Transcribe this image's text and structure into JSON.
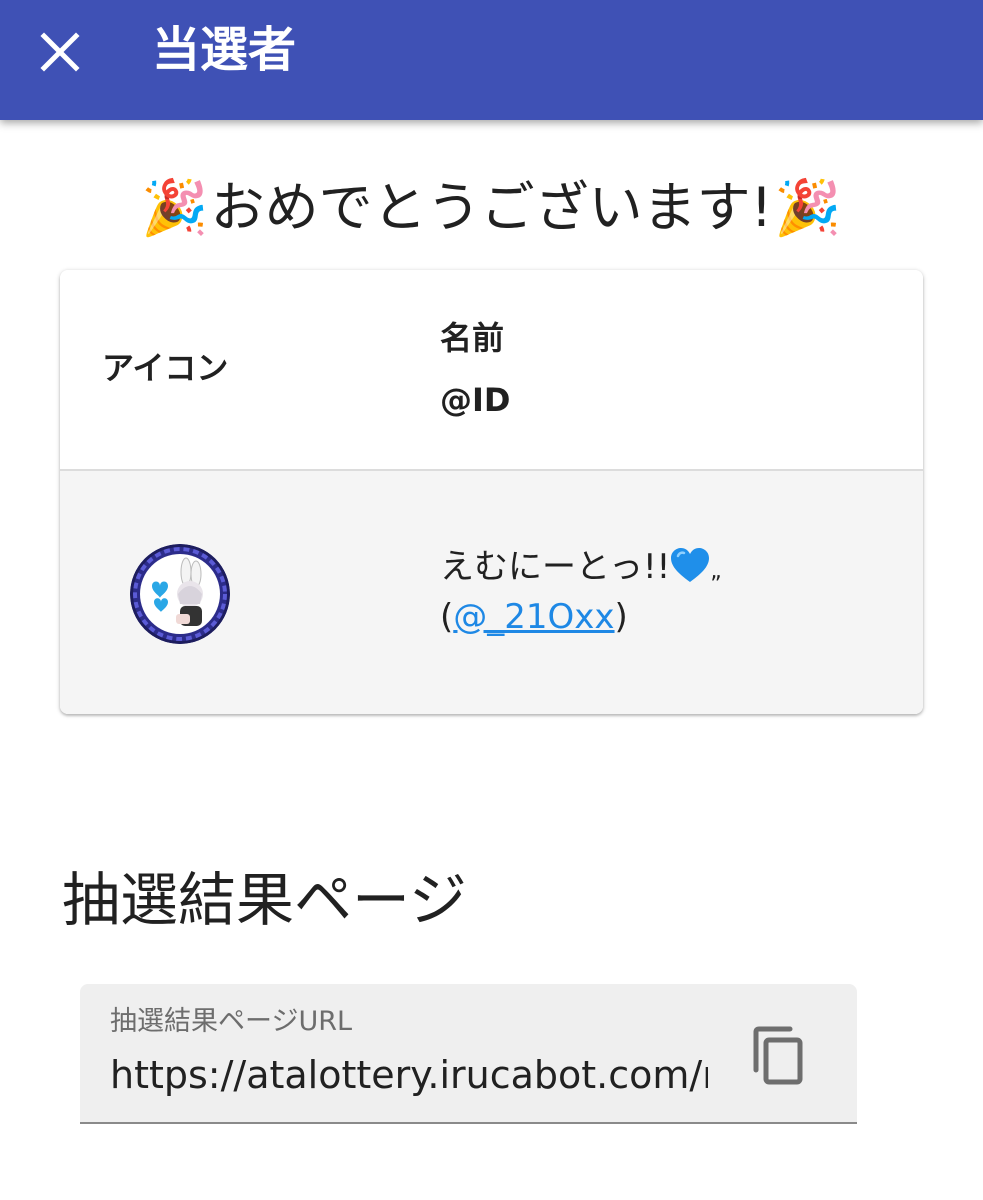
{
  "appbar": {
    "title": "当選者",
    "close_icon": "close-icon",
    "background_color": "#3f51b5"
  },
  "congrats": {
    "text": "おめでとうございます!",
    "emoji_left": "🎉",
    "emoji_right": "🎉"
  },
  "table": {
    "headers": {
      "icon": "アイコン",
      "name": "名前",
      "id": "@ID"
    },
    "rows": [
      {
        "name": "えむにーとっ!!",
        "name_suffix": "„",
        "heart_icon": "blue-heart-icon",
        "id_open": "(",
        "id": "@_21Oxx",
        "id_close": ")",
        "link_color": "#1e88e5"
      }
    ]
  },
  "result_page": {
    "title": "抽選結果ページ",
    "url_label": "抽選結果ページURL",
    "url_value": "https://atalottery.irucabot.com/re",
    "copy_icon": "copy-icon"
  }
}
